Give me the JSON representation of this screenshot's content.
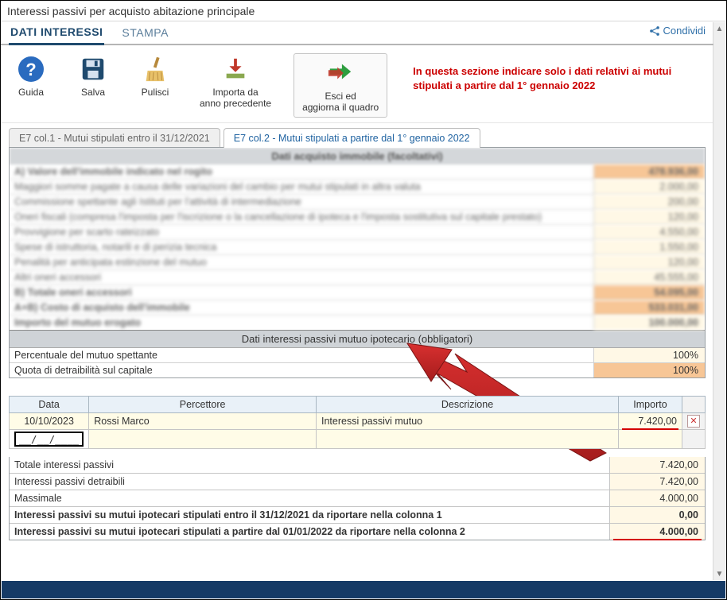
{
  "window": {
    "title": "Interessi passivi per acquisto abitazione principale"
  },
  "nav": {
    "tab1": "DATI INTERESSI",
    "tab2": "STAMPA",
    "share": "Condividi"
  },
  "toolbar": {
    "guida": "Guida",
    "salva": "Salva",
    "pulisci": "Pulisci",
    "importa": "Importa da\nanno precedente",
    "esci": "Esci ed\naggiorna il quadro",
    "hint": "In questa sezione indicare solo i dati relativi ai mutui stipulati a partire dal 1° gennaio 2022"
  },
  "subtabs": {
    "t1": "E7 col.1 - Mutui stipulati entro il 31/12/2021",
    "t2": "E7 col.2 - Mutui stipulati a partire dal 1° gennaio 2022"
  },
  "facoltativi": {
    "header": "Dati acquisto immobile (facoltativi)",
    "rows": [
      {
        "label": "A) Valore dell'immobile indicato nel rogito",
        "value": "478.936,00",
        "bold": true,
        "orange": true
      },
      {
        "label": "Maggiori somme pagate a causa delle variazioni del cambio per mutui stipulati in altra valuta",
        "value": "2.000,00",
        "pale": true
      },
      {
        "label": "Commissione spettante agli Istituti per l'attività di intermediazione",
        "value": "200,00",
        "pale": true
      },
      {
        "label": "Oneri fiscali (compresa l'imposta per l'iscrizione o la cancellazione di ipoteca e l'imposta sostitutiva sul capitale prestato)",
        "value": "120,00",
        "pale": true
      },
      {
        "label": "Provvigione per scarto rateizzato",
        "value": "4.550,00",
        "pale": true
      },
      {
        "label": "Spese di istruttoria, notarili e di perizia tecnica",
        "value": "1.550,00",
        "pale": true
      },
      {
        "label": "Penalità per anticipata estinzione del mutuo",
        "value": "120,00",
        "pale": true
      },
      {
        "label": "Altri oneri accessori",
        "value": "45.555,00",
        "pale": true
      },
      {
        "label": "B) Totale oneri accessori",
        "value": "54.095,00",
        "bold": true,
        "orange": true
      },
      {
        "label": "A+B) Costo di acquisto dell'immobile",
        "value": "533.031,00",
        "bold": true,
        "orange": true
      },
      {
        "label": "Importo del mutuo erogato",
        "value": "100.000,00",
        "bold": true,
        "pale": true
      }
    ]
  },
  "obbligatori": {
    "header": "Dati interessi passivi mutuo ipotecario (obbligatori)",
    "rows": [
      {
        "label": "Percentuale del mutuo spettante",
        "value": "100%"
      },
      {
        "label": "Quota di detraibilità sul capitale",
        "value": "100%",
        "orange": true
      }
    ]
  },
  "entries": {
    "headers": {
      "data": "Data",
      "percettore": "Percettore",
      "descrizione": "Descrizione",
      "importo": "Importo"
    },
    "row1": {
      "data": "10/10/2023",
      "percettore": "Rossi Marco",
      "descrizione": "Interessi passivi mutuo",
      "importo": "7.420,00"
    },
    "row2": {
      "data": "__/__/____",
      "percettore": "",
      "descrizione": "",
      "importo": ""
    }
  },
  "summary": {
    "r1": {
      "label": "Totale interessi passivi",
      "value": "7.420,00"
    },
    "r2": {
      "label": "Interessi passivi detraibili",
      "value": "7.420,00"
    },
    "r3": {
      "label": "Massimale",
      "value": "4.000,00"
    },
    "r4": {
      "label": "Interessi passivi su mutui ipotecari stipulati entro il 31/12/2021 da riportare nella colonna 1",
      "value": "0,00"
    },
    "r5": {
      "label": "Interessi passivi su mutui ipotecari stipulati a partire dal 01/01/2022 da riportare nella colonna 2",
      "value": "4.000,00"
    }
  }
}
